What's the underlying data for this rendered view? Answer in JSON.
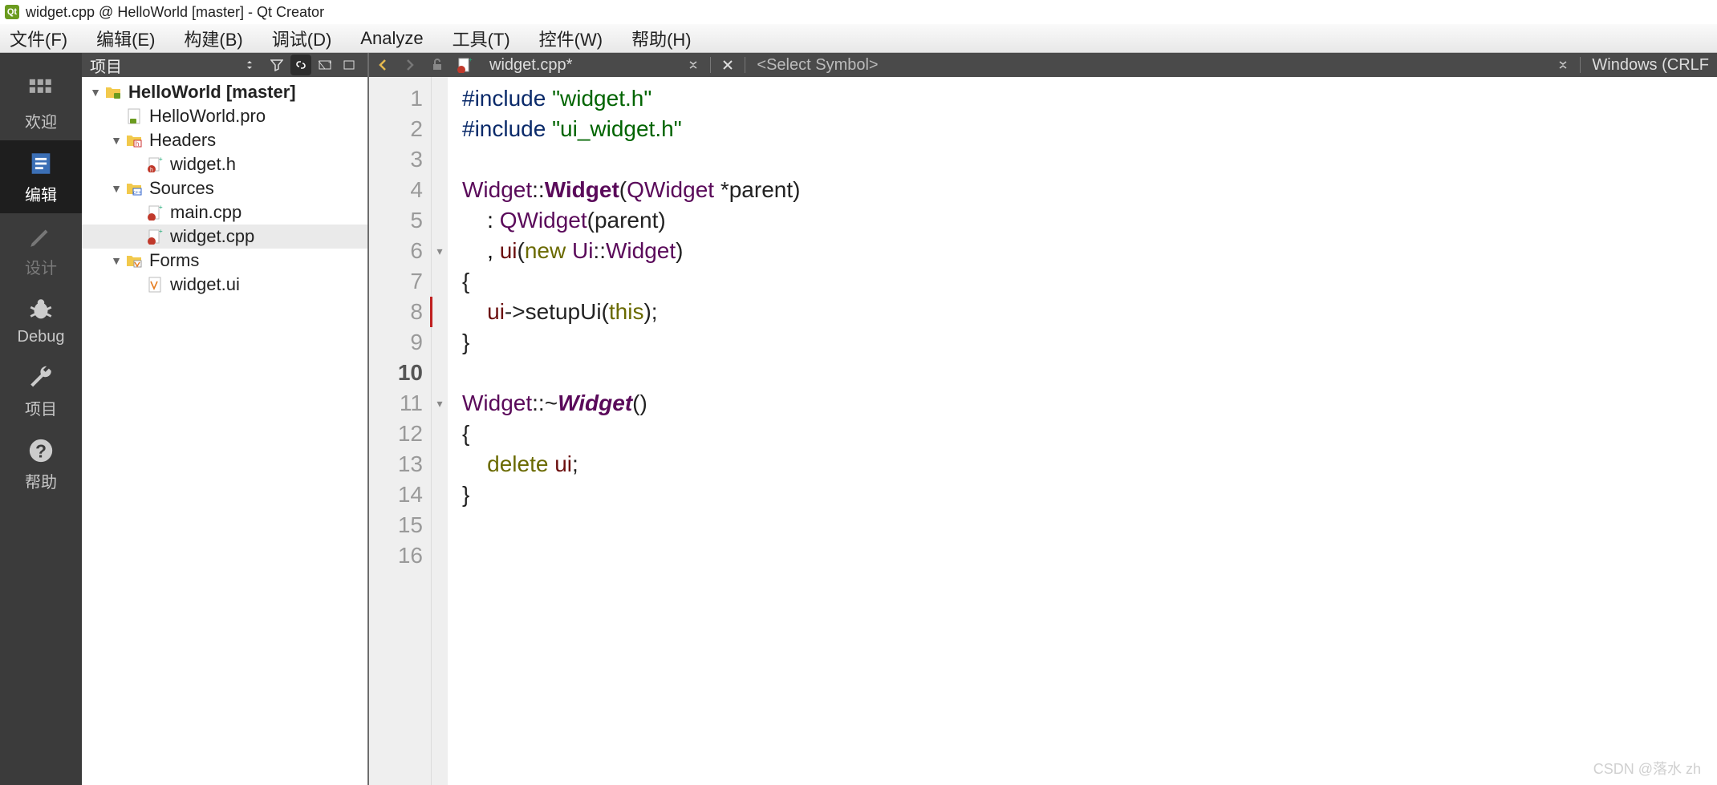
{
  "title": "widget.cpp @ HelloWorld [master] - Qt Creator",
  "menu": {
    "file": "文件(F)",
    "edit": "编辑(E)",
    "build": "构建(B)",
    "debug": "调试(D)",
    "analyze": "Analyze",
    "tools": "工具(T)",
    "widgets": "控件(W)",
    "help": "帮助(H)"
  },
  "modes": {
    "welcome": "欢迎",
    "edit": "编辑",
    "design": "设计",
    "debug": "Debug",
    "projects": "项目",
    "help": "帮助"
  },
  "sidepanel": {
    "title": "项目"
  },
  "tree": {
    "project": "HelloWorld [master]",
    "pro": "HelloWorld.pro",
    "headers": "Headers",
    "widget_h": "widget.h",
    "sources": "Sources",
    "main_cpp": "main.cpp",
    "widget_cpp": "widget.cpp",
    "forms": "Forms",
    "widget_ui": "widget.ui"
  },
  "editor": {
    "filename": "widget.cpp*",
    "symbol_placeholder": "<Select Symbol>",
    "encoding": "Windows (CRLF",
    "lines": {
      "l1a": "#include",
      "l1b": "\"widget.h\"",
      "l2a": "#include",
      "l2b": "\"ui_widget.h\"",
      "l4_pre": "Widget",
      "l4_op": "::",
      "l4_name": "Widget",
      "l4_par": "(",
      "l4_type": "QWidget",
      "l4_rest": " *parent)",
      "l5_pre": "    : ",
      "l5_type": "QWidget",
      "l5_rest": "(parent)",
      "l6_pre": "    , ",
      "l6_ui": "ui",
      "l6_par": "(",
      "l6_new": "new",
      "l6_sp": " ",
      "l6_ns": "Ui",
      "l6_op": "::",
      "l6_w": "Widget",
      "l6_end": ")",
      "l7": "{",
      "l8_pre": "    ",
      "l8_ui": "ui",
      "l8_arrow": "->",
      "l8_call": "setupUi(",
      "l8_this": "this",
      "l8_end": ");",
      "l9": "}",
      "l11_pre": "Widget",
      "l11_op": "::~",
      "l11_name": "Widget",
      "l11_end": "()",
      "l12": "{",
      "l13_pre": "    ",
      "l13_del": "delete",
      "l13_sp": " ",
      "l13_ui": "ui",
      "l13_end": ";",
      "l14": "}"
    },
    "line_numbers": [
      "1",
      "2",
      "3",
      "4",
      "5",
      "6",
      "7",
      "8",
      "9",
      "10",
      "11",
      "12",
      "13",
      "14",
      "15",
      "16"
    ],
    "current_line": 10
  },
  "watermark": "CSDN @落水 zh"
}
